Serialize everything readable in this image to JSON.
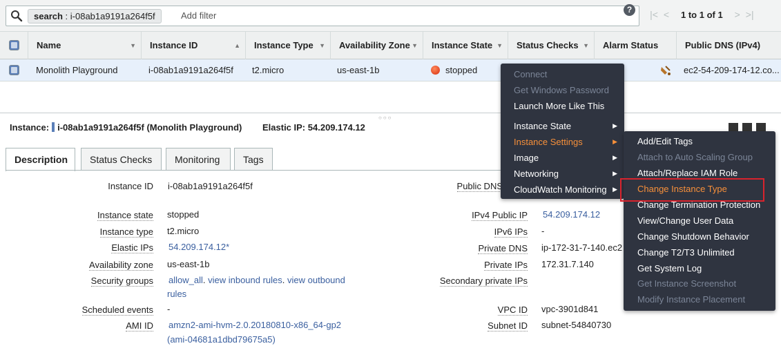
{
  "search": {
    "token_label": "search",
    "token_value": "i-08ab1a9191a264f5f",
    "add_filter": "Add filter",
    "help": "?",
    "pagination": "1 to 1 of 1",
    "first": "|<",
    "prev": "<",
    "next": ">",
    "last": ">|"
  },
  "table": {
    "columns": [
      "Name",
      "Instance ID",
      "Instance Type",
      "Availability Zone",
      "Instance State",
      "Status Checks",
      "Alarm Status",
      "Public DNS (IPv4)"
    ],
    "row": {
      "name": "Monolith Playground",
      "instance_id": "i-08ab1a9191a264f5f",
      "instance_type": "t2.micro",
      "availability_zone": "us-east-1b",
      "instance_state": "stopped",
      "public_dns": "ec2-54-209-174-12.co..."
    }
  },
  "detail": {
    "instance_label": "Instance:",
    "instance_value": "i-08ab1a9191a264f5f (Monolith Playground)",
    "elastic_ip_label": "Elastic IP:",
    "elastic_ip_value": "54.209.174.12",
    "tabs": [
      "Description",
      "Status Checks",
      "Monitoring",
      "Tags"
    ],
    "left_fields": [
      {
        "label": "Instance ID",
        "value": "i-08ab1a9191a264f5f"
      },
      {
        "label": "Instance state",
        "value": "stopped"
      },
      {
        "label": "Instance type",
        "value": "t2.micro"
      },
      {
        "label": "Elastic IPs",
        "value": "54.209.174.12*"
      },
      {
        "label": "Availability zone",
        "value": "us-east-1b"
      },
      {
        "label": "Security groups",
        "value_a": "allow_all",
        "value_b": "view inbound rules",
        "value_c": "view outbound",
        "value_d": "rules"
      },
      {
        "label": "Scheduled events",
        "value": "-"
      },
      {
        "label": "AMI ID",
        "value_a": "amzn2-ami-hvm-2.0.20180810-x86_64-gp2",
        "value_b": "(ami-04681a1dbd79675a5)"
      }
    ],
    "right_fields": [
      {
        "label": "Public DNS",
        "value": ""
      },
      {
        "label": "IPv4 Public IP",
        "value": "54.209.174.12"
      },
      {
        "label": "IPv6 IPs",
        "value": "-"
      },
      {
        "label": "Private DNS",
        "value": "ip-172-31-7-140.ec2"
      },
      {
        "label": "Private IPs",
        "value": "172.31.7.140"
      },
      {
        "label": "Secondary private IPs",
        "value": ""
      },
      {
        "label": "VPC ID",
        "value": "vpc-3901d841"
      },
      {
        "label": "Subnet ID",
        "value": "subnet-54840730"
      }
    ]
  },
  "context_menu": {
    "items": [
      "Connect",
      "Get Windows Password",
      "Launch More Like This",
      "Instance State",
      "Instance Settings",
      "Image",
      "Networking",
      "CloudWatch Monitoring"
    ]
  },
  "submenu": {
    "items": [
      "Add/Edit Tags",
      "Attach to Auto Scaling Group",
      "Attach/Replace IAM Role",
      "Change Instance Type",
      "Change Termination Protection",
      "View/Change User Data",
      "Change Shutdown Behavior",
      "Change T2/T3 Unlimited",
      "Get System Log",
      "Get Instance Screenshot",
      "Modify Instance Placement"
    ]
  },
  "colors": {
    "menu_bg": "#2f3440",
    "menu_active": "#f7903a",
    "menu_disabled": "#7b8597",
    "highlight_border": "#d9232d",
    "link": "#3a5f9f",
    "selected_row": "#e7f0fb"
  }
}
